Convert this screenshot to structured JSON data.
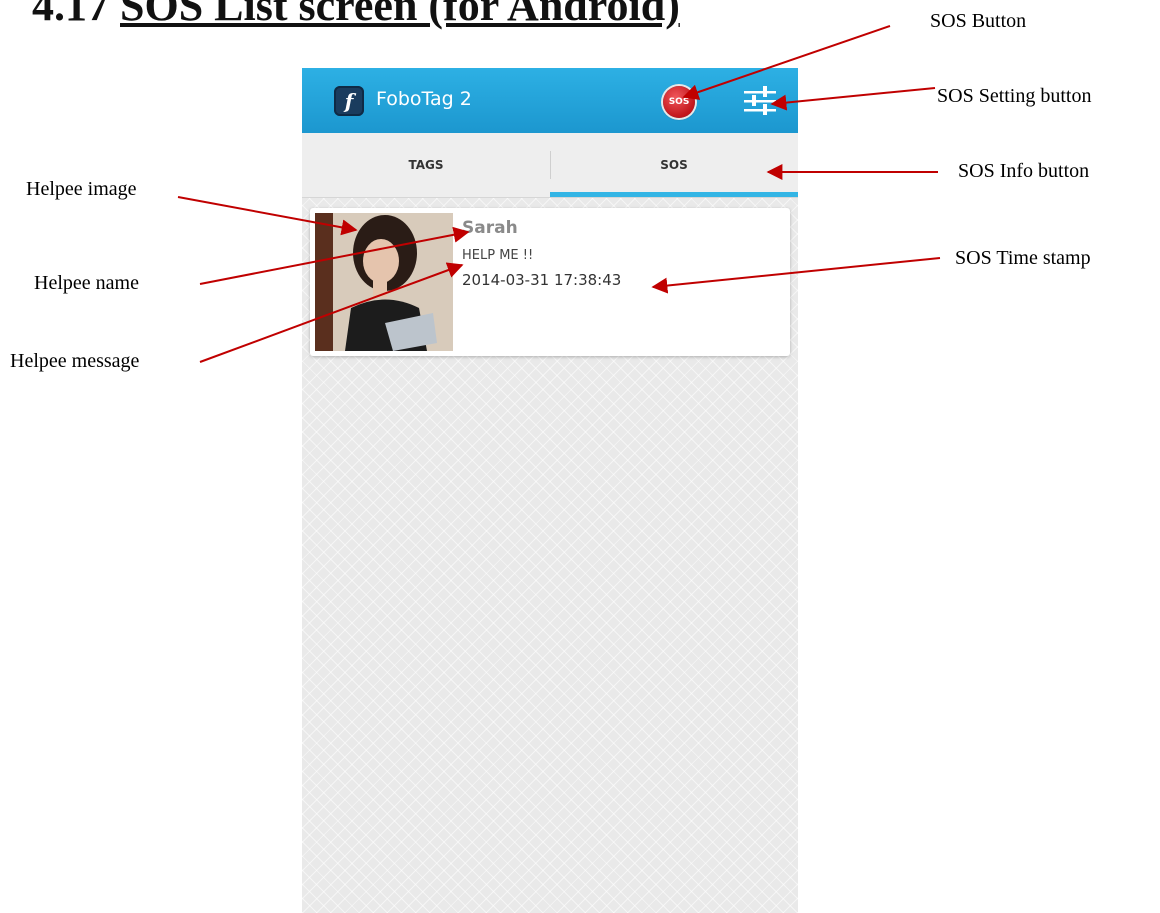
{
  "doc": {
    "heading_prefix": "4.17",
    "heading_title": "SOS List screen (for Android)"
  },
  "app": {
    "title": "FoboTag 2",
    "logo_letter": "f",
    "sos_button_label": "SOS"
  },
  "tabs": [
    {
      "label": "TAGS",
      "selected": false
    },
    {
      "label": "SOS",
      "selected": true
    }
  ],
  "sos_list": [
    {
      "name": "Sarah",
      "message": "HELP ME !!",
      "timestamp": "2014-03-31 17:38:43"
    }
  ],
  "annotations": {
    "sos_button": "SOS Button",
    "sos_setting_button": "SOS Setting button",
    "sos_info_button": "SOS Info button",
    "sos_time_stamp": "SOS Time stamp",
    "helpee_image": "Helpee image",
    "helpee_name": "Helpee name",
    "helpee_message": "Helpee message"
  },
  "colors": {
    "app_bar": "#1fa3da",
    "tab_indicator": "#33b5e5",
    "annotation_arrow": "#c00000",
    "sos_red": "#d2232a"
  }
}
